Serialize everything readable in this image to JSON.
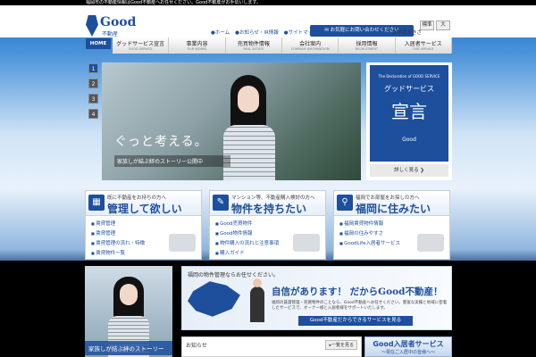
{
  "topbar": {
    "text": "福岡市の不動産情報はGood不動産へお任せください。Good不動産がお手伝いします。"
  },
  "logo": {
    "word": "Good",
    "sub": "不動産"
  },
  "util_links": [
    {
      "label": "●ホーム"
    },
    {
      "label": "●お知らせ・IR情報"
    },
    {
      "label": "●サイトマップ"
    }
  ],
  "contact_button": "✉ お気軽にお問い合わせください",
  "fontsize": {
    "label": "文字の大きさ",
    "normal": "標準",
    "large": "大"
  },
  "home_button": "HOME",
  "gnav": [
    {
      "jp": "グッドサービス宣言",
      "en": "GOOD SERVICE"
    },
    {
      "jp": "事業内容",
      "en": "OUR WORKS"
    },
    {
      "jp": "売買物件情報",
      "en": "REAL ESTATE"
    },
    {
      "jp": "会社案内",
      "en": "COMPANY INFORMATION"
    },
    {
      "jp": "採用情報",
      "en": "RECRUITMENT"
    },
    {
      "jp": "入居者サービス",
      "en": "OUR SERVICE"
    }
  ],
  "slider": {
    "pages": [
      "1",
      "2",
      "3",
      "4"
    ],
    "active": 0
  },
  "hero": {
    "catch": "ぐっと考える。",
    "sub": "家族しが結ぶ絆のストーリー公開中"
  },
  "declaration": {
    "en": "The Declaration of GOOD SERVICE",
    "jp1": "グッドサービス",
    "jp2": "宣言",
    "logo": "Good",
    "more": "詳しく見る ❯"
  },
  "cards": [
    {
      "small": "既に不動産をお持ちの方へ",
      "big": "管理して欲しい",
      "icon": "building-icon",
      "items": [
        "賃貸管理",
        "賃貸管理",
        "賃貸管理の流れ・特徴",
        "賃貸物件一覧"
      ]
    },
    {
      "small": "マンション等、不動産購入検討の方へ",
      "big": "物件を持ちたい",
      "icon": "chat-icon",
      "items": [
        "Good売買物件",
        "Good物件情報",
        "物件購入の流れと注意事項",
        "購入ガイド"
      ]
    },
    {
      "small": "福岡でお部屋をお探しの方へ",
      "big": "福岡に住みたい",
      "icon": "search-icon",
      "items": [
        "福岡賃貸物件情報",
        "福岡の住みやすさ",
        "GoodLife入居者サービス"
      ]
    }
  ],
  "promo": {
    "caption": "家族しが結ぶ絆のストーリー"
  },
  "banner": {
    "t1": "福岡の物件管理ならお任せください。",
    "t2": "自信があります！ だからGood不動産！",
    "t3": "福岡の賃貸管理・売買物件のことなら、Good不動産へお任せください。豊富な実績と地域に密着したサービスで、オーナー様と入居者様をサポートいたします。",
    "btn": "Good不動産だからできるサービスを見る"
  },
  "news": {
    "label": "お知らせ",
    "link": "▸一覧を見る"
  },
  "residents": {
    "a": "Good入居者サービス",
    "b": "〜現在ご入居中の皆様へ〜"
  }
}
